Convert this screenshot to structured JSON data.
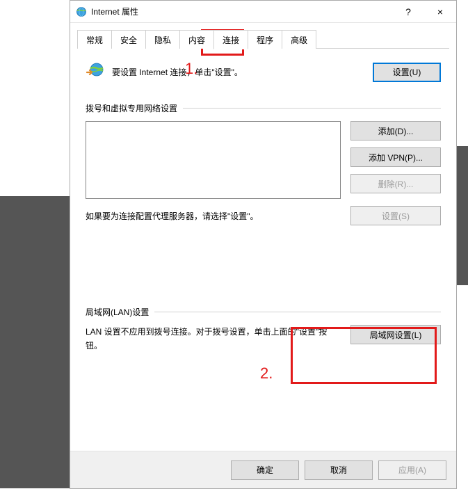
{
  "window": {
    "title": "Internet 属性",
    "help": "?",
    "close": "×"
  },
  "tabs": {
    "t0": "常规",
    "t1": "安全",
    "t2": "隐私",
    "t3": "内容",
    "t4": "连接",
    "t5": "程序",
    "t6": "高级"
  },
  "setup": {
    "text": "要设置 Internet 连接，单击\"设置\"。",
    "button": "设置(U)"
  },
  "dial": {
    "header": "拨号和虚拟专用网络设置",
    "add": "添加(D)...",
    "add_vpn": "添加 VPN(P)...",
    "remove": "删除(R)...",
    "proxy_text": "如果要为连接配置代理服务器，请选择\"设置\"。",
    "settings": "设置(S)"
  },
  "lan": {
    "header": "局域网(LAN)设置",
    "text": "LAN 设置不应用到拨号连接。对于拨号设置，单击上面的\"设置\"按钮。",
    "button": "局域网设置(L)"
  },
  "footer": {
    "ok": "确定",
    "cancel": "取消",
    "apply": "应用(A)"
  },
  "annotations": {
    "a1": "1.",
    "a2": "2."
  }
}
